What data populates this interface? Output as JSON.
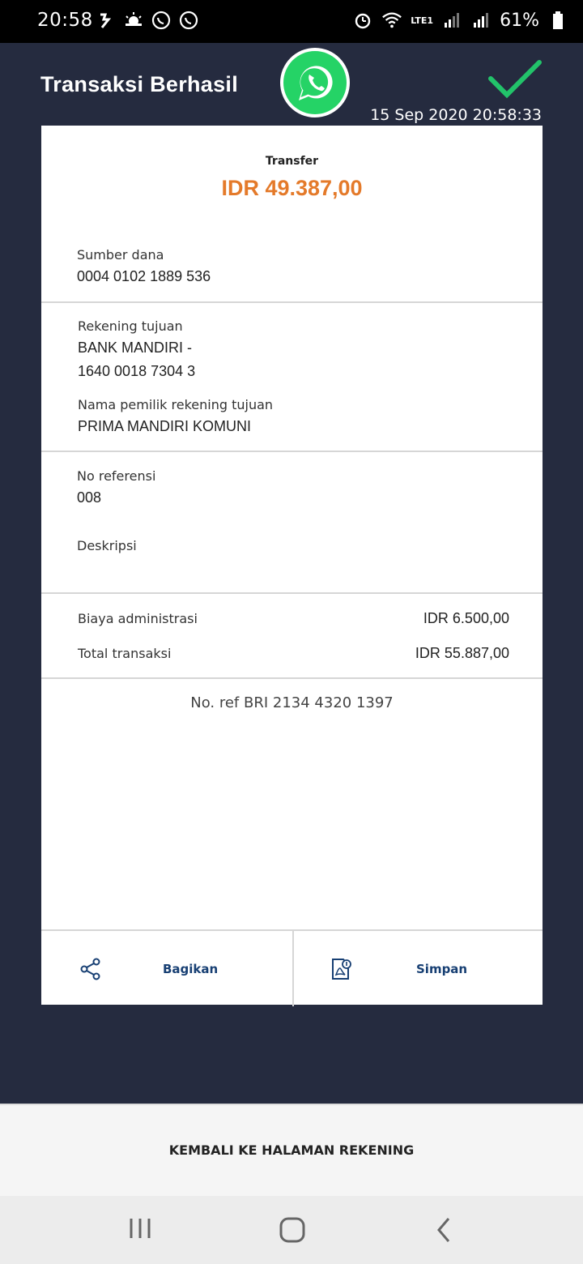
{
  "status_bar": {
    "time": "20:58",
    "battery": "61%",
    "network": "LTE1"
  },
  "header": {
    "title": "Transaksi Berhasil",
    "datetime": "15 Sep 2020 20:58:33"
  },
  "receipt": {
    "type": "Transfer",
    "amount": "IDR 49.387,00",
    "source_label": "Sumber dana",
    "source_value": "0004 0102 1889 536",
    "dest_label": "Rekening tujuan",
    "dest_bank": "BANK MANDIRI -",
    "dest_account": "1640 0018 7304 3",
    "owner_label": "Nama pemilik rekening tujuan",
    "owner_value": "PRIMA MANDIRI KOMUNI",
    "ref_label": "No referensi",
    "ref_value": "008",
    "desc_label": "Deskripsi",
    "desc_value": "",
    "admin_label": "Biaya administrasi",
    "admin_value": "IDR 6.500,00",
    "total_label": "Total transaksi",
    "total_value": "IDR 55.887,00",
    "bri_ref": "No. ref BRI 2134 4320 1397"
  },
  "actions": {
    "share_label": "Bagikan",
    "save_label": "Simpan"
  },
  "bottom": {
    "back_label": "KEMBALI KE HALAMAN REKENING"
  },
  "colors": {
    "background": "#252b3f",
    "amount": "#e47a2a",
    "check": "#22c36a",
    "whatsapp": "#25d366",
    "action_text": "#173f73"
  }
}
